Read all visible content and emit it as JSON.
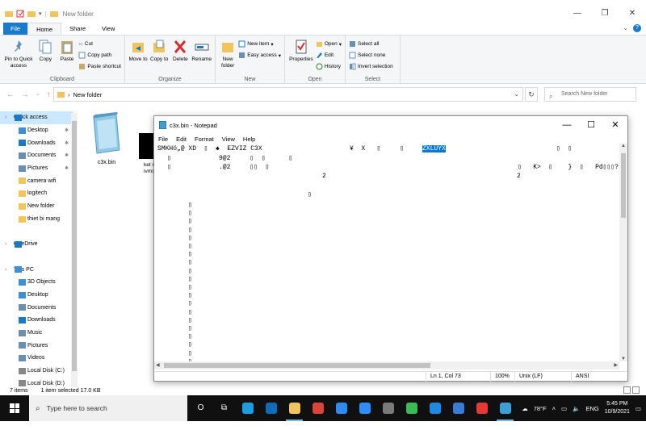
{
  "explorer": {
    "title": "New folder",
    "tabs": [
      "File",
      "Home",
      "Share",
      "View"
    ],
    "ribbon": {
      "clipboard": {
        "label": "Clipboard",
        "pin": "Pin to Quick access",
        "copy": "Copy",
        "paste": "Paste",
        "cut": "Cut",
        "copy_path": "Copy path",
        "paste_shortcut": "Paste shortcut"
      },
      "organize": {
        "label": "Organize",
        "move_to": "Move to",
        "copy_to": "Copy to",
        "delete": "Delete",
        "rename": "Rename"
      },
      "new": {
        "label": "New",
        "new_folder": "New folder",
        "new_item": "New item",
        "easy_access": "Easy access"
      },
      "open": {
        "label": "Open",
        "properties": "Properties",
        "open": "Open",
        "edit": "Edit",
        "history": "History"
      },
      "select": {
        "label": "Select",
        "select_all": "Select all",
        "select_none": "Select none",
        "invert": "Invert selection"
      }
    },
    "address": "New folder",
    "search_placeholder": "Search New folder",
    "nav": [
      {
        "label": "Quick access",
        "icon": "star-icon",
        "top": true,
        "selected": true
      },
      {
        "label": "Desktop",
        "icon": "desktop-icon",
        "pin": true
      },
      {
        "label": "Downloads",
        "icon": "download-icon",
        "pin": true
      },
      {
        "label": "Documents",
        "icon": "documents-icon",
        "pin": true
      },
      {
        "label": "Pictures",
        "icon": "pictures-icon",
        "pin": true
      },
      {
        "label": "camera wifi",
        "icon": "folder-icon"
      },
      {
        "label": "logitech",
        "icon": "folder-icon"
      },
      {
        "label": "New folder",
        "icon": "folder-icon"
      },
      {
        "label": "thiet bi mang",
        "icon": "folder-icon"
      },
      {
        "label": "",
        "icon": ""
      },
      {
        "label": "OneDrive",
        "icon": "cloud-icon",
        "top": true
      },
      {
        "label": "",
        "icon": ""
      },
      {
        "label": "This PC",
        "icon": "computer-icon",
        "top": true
      },
      {
        "label": "3D Objects",
        "icon": "cube-icon"
      },
      {
        "label": "Desktop",
        "icon": "desktop-icon"
      },
      {
        "label": "Documents",
        "icon": "documents-icon"
      },
      {
        "label": "Downloads",
        "icon": "download-icon"
      },
      {
        "label": "Music",
        "icon": "music-icon"
      },
      {
        "label": "Pictures",
        "icon": "pictures-icon"
      },
      {
        "label": "Videos",
        "icon": "video-icon"
      },
      {
        "label": "Local Disk (C:)",
        "icon": "disk-icon"
      },
      {
        "label": "Local Disk (D:)",
        "icon": "disk-icon"
      }
    ],
    "files": [
      {
        "name": "c3x.bin"
      },
      {
        "name_line1": "ket n",
        "name_line2": "ivms"
      }
    ],
    "status": {
      "items": "7 items",
      "selected": "1 item selected  17.0 KB"
    }
  },
  "notepad": {
    "title": "c3x.bin - Notepad",
    "menu": [
      "File",
      "Edit",
      "Format",
      "View",
      "Help"
    ],
    "lines": [
      {
        "text": "SMKHö„@ XD  ▯  ♠  EZVIZ C3X"
      },
      {
        "text": "¥  X   ▯     ▯"
      },
      {
        "text": "ZXLUYX",
        "highlight": true
      },
      {
        "text": "▯  ▯"
      },
      {
        "text": "▯"
      },
      {
        "text": "9@2     ▯  ▯      ▯"
      },
      {
        "text": "▯   Ƙ>  ▯    }  ▯   Pd▯▯▯?"
      },
      {
        "text": "▯"
      },
      {
        "text": ".@2     ▯▯  ▯"
      },
      {
        "text": "2"
      },
      {
        "text": "2"
      },
      {
        "text": "▯"
      }
    ],
    "gutter_char": "▯",
    "gutter_count": 23,
    "status": {
      "position": "Ln 1, Col 73",
      "zoom": "100%",
      "eol": "Unix (LF)",
      "encoding": "ANSI"
    }
  },
  "taskbar": {
    "search_placeholder": "Type here to search",
    "weather": "78°F",
    "language": "ENG",
    "time": "5:45 PM",
    "date": "10/9/2021",
    "apps": [
      {
        "name": "cortana",
        "color": "#101010",
        "glyph": "O"
      },
      {
        "name": "task-view",
        "color": "#101010",
        "glyph": "⧉"
      },
      {
        "name": "edge",
        "color": "#1b9de2"
      },
      {
        "name": "edge-legacy",
        "color": "#0f6cbd"
      },
      {
        "name": "file-explorer",
        "color": "#f2c55c",
        "active": true
      },
      {
        "name": "chrome",
        "color": "#db4437"
      },
      {
        "name": "app-blue",
        "color": "#2d8cf0"
      },
      {
        "name": "zoom",
        "color": "#2d8cff"
      },
      {
        "name": "app-grey",
        "color": "#7a7a7a"
      },
      {
        "name": "app-green",
        "color": "#3cba54"
      },
      {
        "name": "app-blue2",
        "color": "#1e88e5"
      },
      {
        "name": "app-teal",
        "color": "#3a7bd5"
      },
      {
        "name": "app-red",
        "color": "#e53935"
      },
      {
        "name": "notepad",
        "color": "#3b9fd8",
        "active": true
      }
    ]
  },
  "colors": {
    "accent": "#1979ca",
    "selection": "#0078d7",
    "nav_selected": "#cce8ff",
    "taskbar": "#101010",
    "folder": "#f2c55c"
  }
}
